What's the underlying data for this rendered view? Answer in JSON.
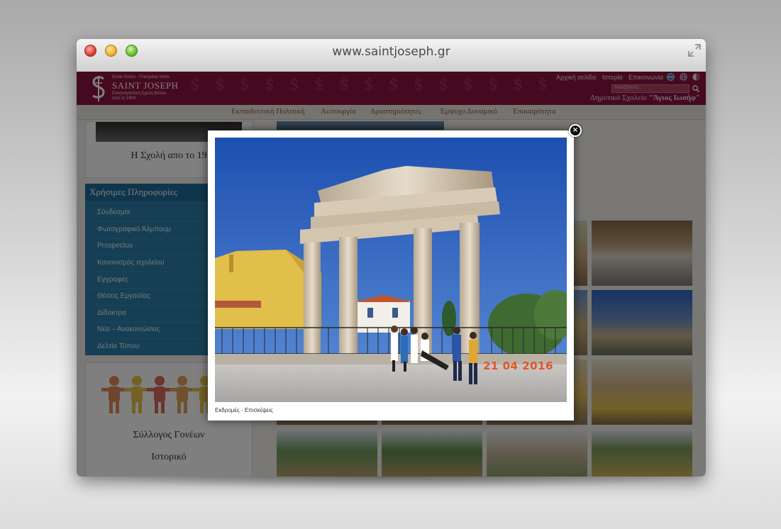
{
  "browser": {
    "url": "www.saintjoseph.gr"
  },
  "header": {
    "logo_small": "Ecole Greco - Française Volos",
    "logo_main": "SAINT JOSEPH",
    "logo_sub1": "Ελληνογαλλική Σχολή Βόλου",
    "logo_sub2": "από το 1904",
    "links": [
      "Αρχική σελίδα",
      "Ιστορία",
      "Επικοινωνία"
    ],
    "search_placeholder": "Αναζήτηση...",
    "school_prefix": "Δημοτικό Σχολείο ",
    "school_name": "\"Άγιος Ιωσήφ\""
  },
  "menu": [
    "Εκπαιδευτική Πολιτική",
    "Λειτουργία",
    "Δραστηριότητες",
    "Έμψυχο Δυναμικό",
    "Επικαιρότητα"
  ],
  "sidebar": {
    "history_title": "Η Σχολή απο το 19",
    "useful_title": "Χρήσιμες Πληροφορίες",
    "useful_items": [
      "Σύνδεσμοι",
      "Φωτογραφικό Άλμπουμ",
      "Prospectus",
      "Κανονισμός σχολείου",
      "Εγγραφές",
      "Θέσεις Εργασίας",
      "Δίδακτρα",
      "Νέα – Ανακοινώσεις",
      "Δελτία Τύπου"
    ],
    "parents_title": "Σύλλογος Γονέων",
    "history_link": "Ιστορικό"
  },
  "lightbox": {
    "caption": "Εκδρομές - Επισκέψεις",
    "datestamp": "21 04 2016",
    "close_symbol": "×"
  },
  "colors": {
    "brand": "#8c1540",
    "sidebar_blue": "#2c7eab",
    "menu_text": "#8a5a30"
  }
}
